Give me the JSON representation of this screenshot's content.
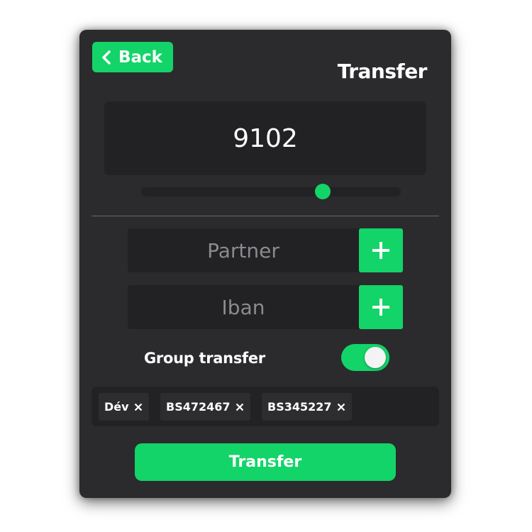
{
  "header": {
    "back_label": "Back",
    "title": "Transfer"
  },
  "amount": {
    "value": "9102",
    "slider_fraction": 0.7
  },
  "fields": {
    "partner_placeholder": "Partner",
    "iban_placeholder": "Iban"
  },
  "group_transfer": {
    "label": "Group transfer",
    "enabled": true
  },
  "tags": [
    {
      "label": "Dév"
    },
    {
      "label": "BS472467"
    },
    {
      "label": "BS345227"
    }
  ],
  "submit": {
    "label": "Transfer"
  },
  "colors": {
    "accent": "#13d468",
    "panel": "#2b2b2e",
    "input_bg": "#222225"
  },
  "icons": {
    "back": "chevron-left-icon",
    "add": "plus-icon",
    "remove_tag": "close-icon"
  }
}
